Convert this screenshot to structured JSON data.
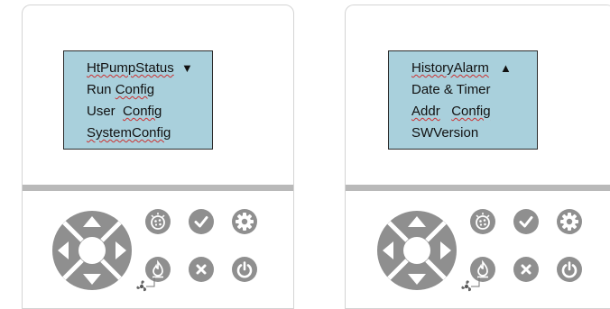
{
  "panels": [
    {
      "screen": {
        "line1": "HtPumpStatus",
        "line2_a": "Run",
        "line2_b": "Config",
        "line3_a": "User",
        "line3_b": "Config",
        "line4": "SystemConfig",
        "scroll_indicator": "▼"
      }
    },
    {
      "screen": {
        "line1": "HistoryAlarm",
        "line2": "Date & Timer",
        "line3_a": "Addr",
        "line3_b": "Config",
        "line4": "SWVersion",
        "scroll_indicator": "▲"
      }
    }
  ],
  "buttons": {
    "dpad": [
      "up-arrow-icon",
      "down-arrow-icon",
      "left-arrow-icon",
      "right-arrow-icon"
    ],
    "function_buttons": [
      "mode-icon",
      "check-icon",
      "gear-icon",
      "flame-icon",
      "close-icon",
      "power-icon",
      "fan-icon"
    ]
  },
  "colors": {
    "lcd_background": "#a9d0dc",
    "button_gray": "#8f8f8f",
    "divider_gray": "#b9b9b9",
    "spellcheck_red": "#cc3030"
  }
}
